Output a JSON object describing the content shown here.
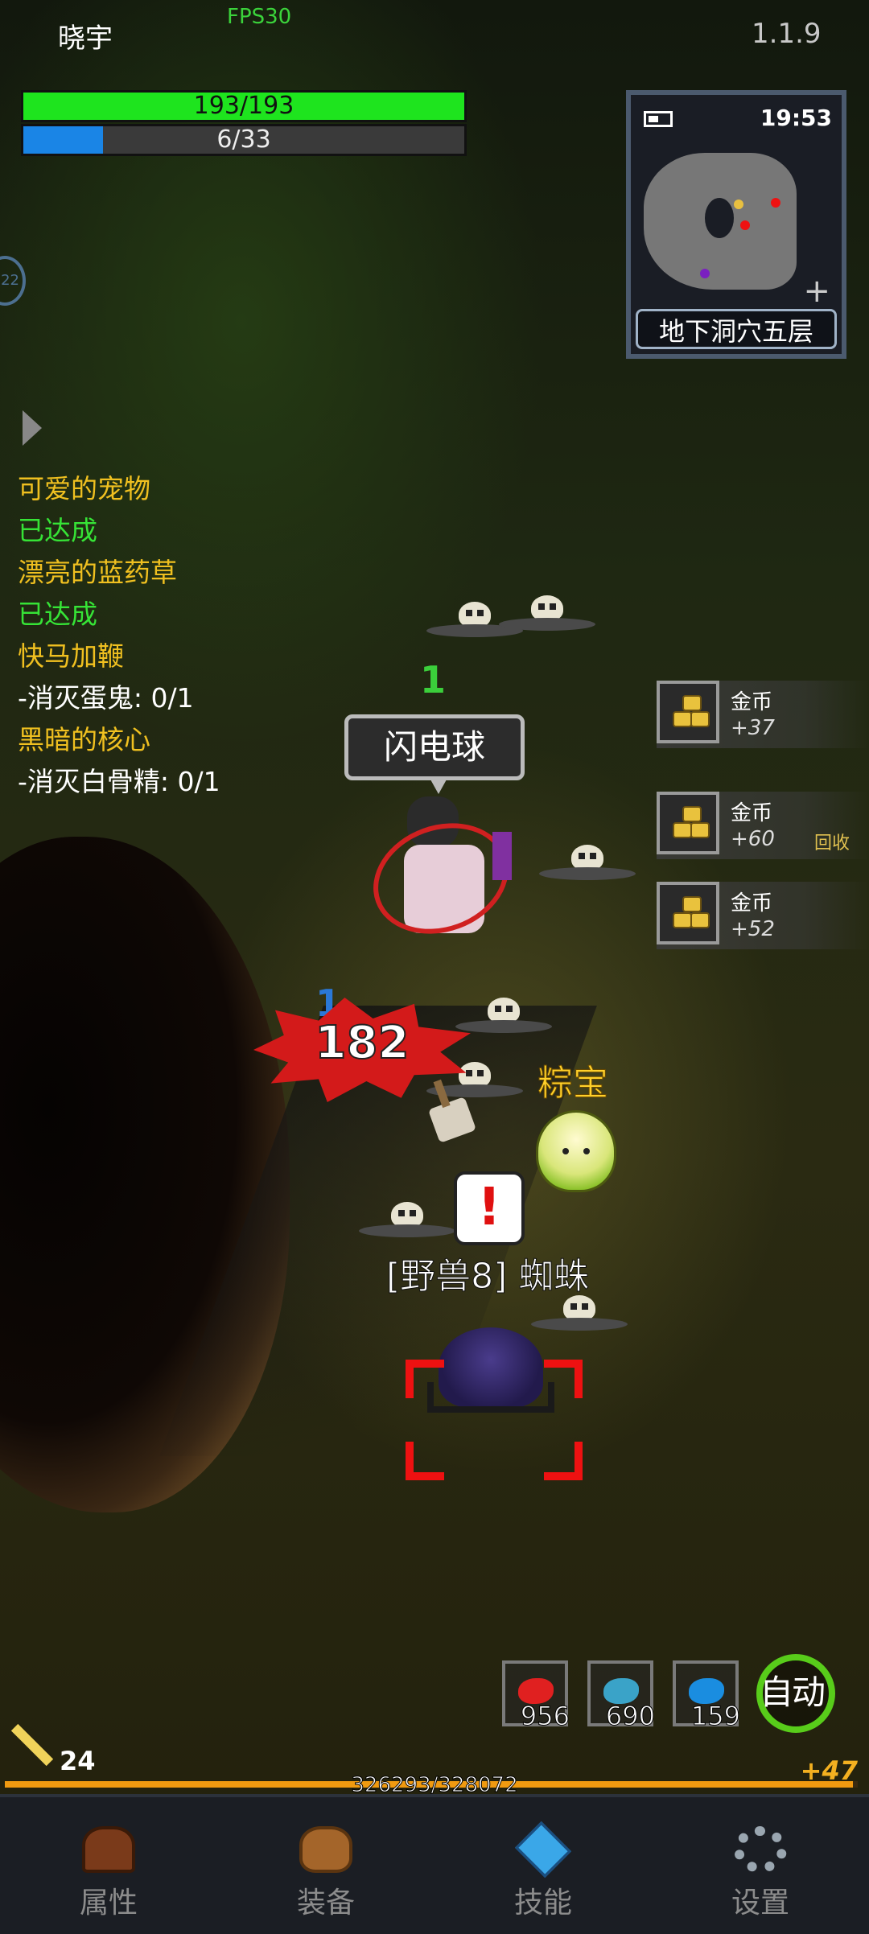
{
  "header": {
    "player_name": "晓宇",
    "fps": "FPS30",
    "version": "1.1.9"
  },
  "status": {
    "hp_text": "193/193",
    "hp_fraction": 1.0,
    "mp_text": "6/33",
    "mp_fraction": 0.18,
    "hp_color": "#1ee41e",
    "mp_color": "#1a85e6"
  },
  "minimap": {
    "time": "19:53",
    "zone_name": "地下洞穴五层",
    "battery_icon": "battery-icon",
    "zoom_icon": "plus-icon"
  },
  "side": {
    "orb_text": "22"
  },
  "quests": [
    {
      "title": "可爱的宠物",
      "status": "已达成"
    },
    {
      "title": "漂亮的蓝药草",
      "status": "已达成"
    },
    {
      "title": "快马加鞭",
      "status": "-消灭蛋鬼: 0/1"
    },
    {
      "title": "黑暗的核心",
      "status": "-消灭白骨精: 0/1"
    }
  ],
  "combat": {
    "skill_name": "闪电球",
    "combo_top": "1",
    "combo_left": "1",
    "damage": "182",
    "pet_name": "粽宝",
    "alert_symbol": "!",
    "enemy_label": "[野兽8] 蜘蛛"
  },
  "loot_feed": [
    {
      "name": "金币",
      "amount": "+37",
      "tag": ""
    },
    {
      "name": "金币",
      "amount": "+60",
      "tag": "回收"
    },
    {
      "name": "金币",
      "amount": "+52",
      "tag": ""
    }
  ],
  "consumables": [
    {
      "icon": "red-potion-icon",
      "count": "956",
      "color": "#e02020"
    },
    {
      "icon": "fish-icon",
      "count": "690",
      "color": "#3aa3c8"
    },
    {
      "icon": "blue-potion-icon",
      "count": "159",
      "color": "#1a8de0"
    }
  ],
  "auto_button": "自动",
  "level": {
    "value": "24"
  },
  "experience": {
    "text": "326293/328072",
    "fraction": 0.9946,
    "gain": "+47"
  },
  "nav": [
    {
      "label": "属性",
      "icon": "helmet-icon"
    },
    {
      "label": "装备",
      "icon": "bag-icon"
    },
    {
      "label": "技能",
      "icon": "skill-gem-icon"
    },
    {
      "label": "设置",
      "icon": "gear-icon"
    }
  ]
}
